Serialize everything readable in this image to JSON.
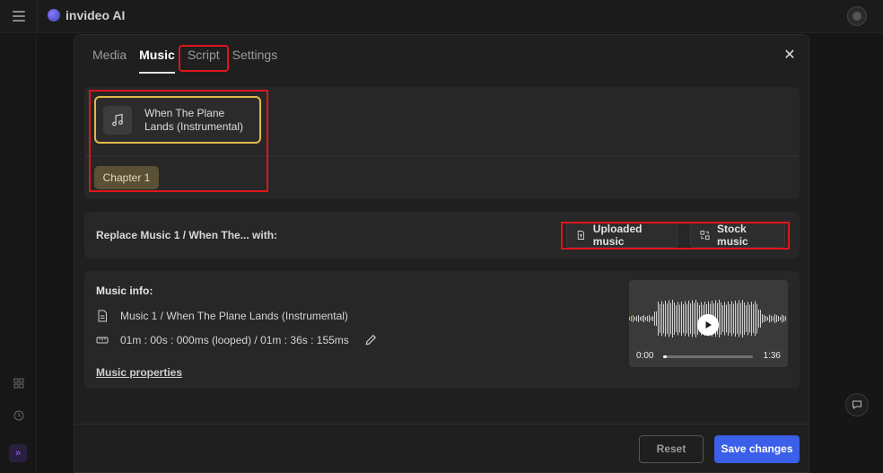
{
  "app": {
    "logo_text": "invideo AI"
  },
  "modal": {
    "tabs": [
      {
        "label": "Media"
      },
      {
        "label": "Music"
      },
      {
        "label": "Script"
      },
      {
        "label": "Settings"
      }
    ],
    "active_tab": "Music",
    "close_icon": "close-icon"
  },
  "chapters": {
    "music_card_title": "When The Plane Lands (Instrumental)",
    "music_card_icon": "music-note-icon",
    "chip_label": "Chapter 1"
  },
  "replace": {
    "label": "Replace Music 1 / When The... with:",
    "uploaded_label": "Uploaded music",
    "stock_label": "Stock music"
  },
  "info": {
    "title": "Music info:",
    "name": "Music 1 / When The Plane Lands (Instrumental)",
    "duration": "01m : 00s : 000ms (looped) / 01m : 36s : 155ms",
    "properties_link": "Music properties"
  },
  "player": {
    "time_current": "0:00",
    "time_total": "1:36",
    "progress": 0.04
  },
  "footer": {
    "reset_label": "Reset",
    "save_label": "Save changes"
  },
  "colors": {
    "accent_blue": "#3b5fe8",
    "selected_border": "#e3b94a",
    "chapter_chip": "#5a5035",
    "highlight_red": "#e0151c"
  }
}
